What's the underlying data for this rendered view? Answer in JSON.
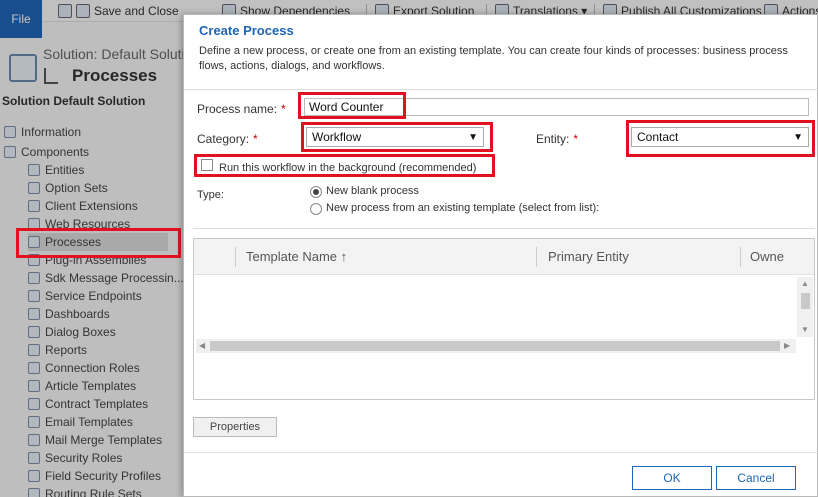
{
  "ribbon": {
    "file_label": "File",
    "save_close": "Save and Close",
    "show_dependencies": "Show Dependencies",
    "export_solution": "Export Solution",
    "translations": "Translations ▾",
    "publish_all": "Publish All Customizations",
    "actions": "Actions"
  },
  "solution": {
    "subtitle": "Solution: Default Solutio",
    "title": "Processes",
    "name": "Solution Default Solution"
  },
  "tree": {
    "items": [
      {
        "label": "Information"
      },
      {
        "label": "Components"
      },
      {
        "label": "Entities"
      },
      {
        "label": "Option Sets"
      },
      {
        "label": "Client Extensions"
      },
      {
        "label": "Web Resources"
      },
      {
        "label": "Processes"
      },
      {
        "label": "Plug-in Assemblies"
      },
      {
        "label": "Sdk Message Processin..."
      },
      {
        "label": "Service Endpoints"
      },
      {
        "label": "Dashboards"
      },
      {
        "label": "Dialog Boxes"
      },
      {
        "label": "Reports"
      },
      {
        "label": "Connection Roles"
      },
      {
        "label": "Article Templates"
      },
      {
        "label": "Contract Templates"
      },
      {
        "label": "Email Templates"
      },
      {
        "label": "Mail Merge Templates"
      },
      {
        "label": "Security Roles"
      },
      {
        "label": "Field Security Profiles"
      },
      {
        "label": "Routing Rule Sets"
      }
    ]
  },
  "dialog": {
    "title": "Create Process",
    "description": "Define a new process, or create one from an existing template. You can create four kinds of processes: business process flows, actions, dialogs, and workflows.",
    "process_name_label": "Process name:",
    "process_name_value": "Word Counter",
    "category_label": "Category:",
    "category_value": "Workflow",
    "entity_label": "Entity:",
    "entity_value": "Contact",
    "required_mark": "*",
    "background_checkbox_label": "Run this workflow in the background (recommended)",
    "type_label": "Type:",
    "type_options": [
      "New blank process",
      "New process from an existing template (select from list):"
    ],
    "grid_columns": [
      "Template Name ↑",
      "Primary Entity",
      "Owne"
    ],
    "properties_button": "Properties",
    "ok_button": "OK",
    "cancel_button": "Cancel"
  }
}
